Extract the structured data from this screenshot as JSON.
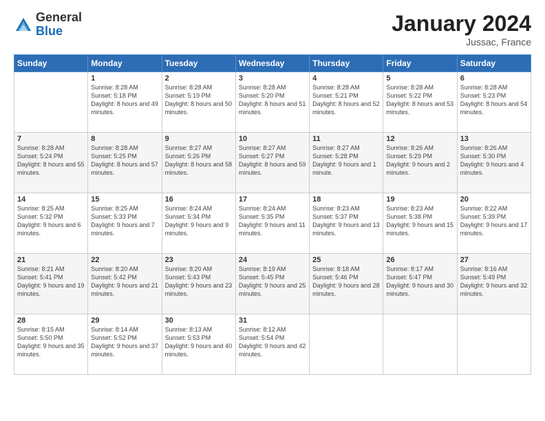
{
  "logo": {
    "general": "General",
    "blue": "Blue"
  },
  "title": "January 2024",
  "location": "Jussac, France",
  "days_header": [
    "Sunday",
    "Monday",
    "Tuesday",
    "Wednesday",
    "Thursday",
    "Friday",
    "Saturday"
  ],
  "weeks": [
    [
      {
        "day": "",
        "sunrise": "",
        "sunset": "",
        "daylight": ""
      },
      {
        "day": "1",
        "sunrise": "Sunrise: 8:28 AM",
        "sunset": "Sunset: 5:18 PM",
        "daylight": "Daylight: 8 hours and 49 minutes."
      },
      {
        "day": "2",
        "sunrise": "Sunrise: 8:28 AM",
        "sunset": "Sunset: 5:19 PM",
        "daylight": "Daylight: 8 hours and 50 minutes."
      },
      {
        "day": "3",
        "sunrise": "Sunrise: 8:28 AM",
        "sunset": "Sunset: 5:20 PM",
        "daylight": "Daylight: 8 hours and 51 minutes."
      },
      {
        "day": "4",
        "sunrise": "Sunrise: 8:28 AM",
        "sunset": "Sunset: 5:21 PM",
        "daylight": "Daylight: 8 hours and 52 minutes."
      },
      {
        "day": "5",
        "sunrise": "Sunrise: 8:28 AM",
        "sunset": "Sunset: 5:22 PM",
        "daylight": "Daylight: 8 hours and 53 minutes."
      },
      {
        "day": "6",
        "sunrise": "Sunrise: 8:28 AM",
        "sunset": "Sunset: 5:23 PM",
        "daylight": "Daylight: 8 hours and 54 minutes."
      }
    ],
    [
      {
        "day": "7",
        "sunrise": "Sunrise: 8:28 AM",
        "sunset": "Sunset: 5:24 PM",
        "daylight": "Daylight: 8 hours and 55 minutes."
      },
      {
        "day": "8",
        "sunrise": "Sunrise: 8:28 AM",
        "sunset": "Sunset: 5:25 PM",
        "daylight": "Daylight: 8 hours and 57 minutes."
      },
      {
        "day": "9",
        "sunrise": "Sunrise: 8:27 AM",
        "sunset": "Sunset: 5:26 PM",
        "daylight": "Daylight: 8 hours and 58 minutes."
      },
      {
        "day": "10",
        "sunrise": "Sunrise: 8:27 AM",
        "sunset": "Sunset: 5:27 PM",
        "daylight": "Daylight: 8 hours and 59 minutes."
      },
      {
        "day": "11",
        "sunrise": "Sunrise: 8:27 AM",
        "sunset": "Sunset: 5:28 PM",
        "daylight": "Daylight: 9 hours and 1 minute."
      },
      {
        "day": "12",
        "sunrise": "Sunrise: 8:26 AM",
        "sunset": "Sunset: 5:29 PM",
        "daylight": "Daylight: 9 hours and 2 minutes."
      },
      {
        "day": "13",
        "sunrise": "Sunrise: 8:26 AM",
        "sunset": "Sunset: 5:30 PM",
        "daylight": "Daylight: 9 hours and 4 minutes."
      }
    ],
    [
      {
        "day": "14",
        "sunrise": "Sunrise: 8:25 AM",
        "sunset": "Sunset: 5:32 PM",
        "daylight": "Daylight: 9 hours and 6 minutes."
      },
      {
        "day": "15",
        "sunrise": "Sunrise: 8:25 AM",
        "sunset": "Sunset: 5:33 PM",
        "daylight": "Daylight: 9 hours and 7 minutes."
      },
      {
        "day": "16",
        "sunrise": "Sunrise: 8:24 AM",
        "sunset": "Sunset: 5:34 PM",
        "daylight": "Daylight: 9 hours and 9 minutes."
      },
      {
        "day": "17",
        "sunrise": "Sunrise: 8:24 AM",
        "sunset": "Sunset: 5:35 PM",
        "daylight": "Daylight: 9 hours and 11 minutes."
      },
      {
        "day": "18",
        "sunrise": "Sunrise: 8:23 AM",
        "sunset": "Sunset: 5:37 PM",
        "daylight": "Daylight: 9 hours and 13 minutes."
      },
      {
        "day": "19",
        "sunrise": "Sunrise: 8:23 AM",
        "sunset": "Sunset: 5:38 PM",
        "daylight": "Daylight: 9 hours and 15 minutes."
      },
      {
        "day": "20",
        "sunrise": "Sunrise: 8:22 AM",
        "sunset": "Sunset: 5:39 PM",
        "daylight": "Daylight: 9 hours and 17 minutes."
      }
    ],
    [
      {
        "day": "21",
        "sunrise": "Sunrise: 8:21 AM",
        "sunset": "Sunset: 5:41 PM",
        "daylight": "Daylight: 9 hours and 19 minutes."
      },
      {
        "day": "22",
        "sunrise": "Sunrise: 8:20 AM",
        "sunset": "Sunset: 5:42 PM",
        "daylight": "Daylight: 9 hours and 21 minutes."
      },
      {
        "day": "23",
        "sunrise": "Sunrise: 8:20 AM",
        "sunset": "Sunset: 5:43 PM",
        "daylight": "Daylight: 9 hours and 23 minutes."
      },
      {
        "day": "24",
        "sunrise": "Sunrise: 8:19 AM",
        "sunset": "Sunset: 5:45 PM",
        "daylight": "Daylight: 9 hours and 25 minutes."
      },
      {
        "day": "25",
        "sunrise": "Sunrise: 8:18 AM",
        "sunset": "Sunset: 5:46 PM",
        "daylight": "Daylight: 9 hours and 28 minutes."
      },
      {
        "day": "26",
        "sunrise": "Sunrise: 8:17 AM",
        "sunset": "Sunset: 5:47 PM",
        "daylight": "Daylight: 9 hours and 30 minutes."
      },
      {
        "day": "27",
        "sunrise": "Sunrise: 8:16 AM",
        "sunset": "Sunset: 5:49 PM",
        "daylight": "Daylight: 9 hours and 32 minutes."
      }
    ],
    [
      {
        "day": "28",
        "sunrise": "Sunrise: 8:15 AM",
        "sunset": "Sunset: 5:50 PM",
        "daylight": "Daylight: 9 hours and 35 minutes."
      },
      {
        "day": "29",
        "sunrise": "Sunrise: 8:14 AM",
        "sunset": "Sunset: 5:52 PM",
        "daylight": "Daylight: 9 hours and 37 minutes."
      },
      {
        "day": "30",
        "sunrise": "Sunrise: 8:13 AM",
        "sunset": "Sunset: 5:53 PM",
        "daylight": "Daylight: 9 hours and 40 minutes."
      },
      {
        "day": "31",
        "sunrise": "Sunrise: 8:12 AM",
        "sunset": "Sunset: 5:54 PM",
        "daylight": "Daylight: 9 hours and 42 minutes."
      },
      {
        "day": "",
        "sunrise": "",
        "sunset": "",
        "daylight": ""
      },
      {
        "day": "",
        "sunrise": "",
        "sunset": "",
        "daylight": ""
      },
      {
        "day": "",
        "sunrise": "",
        "sunset": "",
        "daylight": ""
      }
    ]
  ]
}
